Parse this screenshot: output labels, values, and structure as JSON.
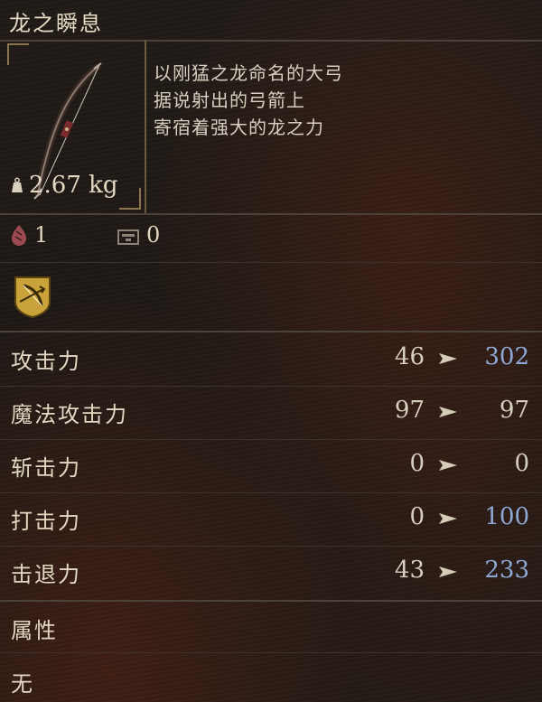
{
  "item": {
    "name": "龙之瞬息",
    "weight": "2.67 kg",
    "description": [
      "以刚猛之龙命名的大弓",
      "据说射出的弓箭上",
      "寄宿着强大的龙之力"
    ]
  },
  "requirements": {
    "fp_cost": "1",
    "stamina_cost": "0"
  },
  "stats": [
    {
      "label": "攻击力",
      "base": "46",
      "new": "302",
      "change": "up"
    },
    {
      "label": "魔法攻击力",
      "base": "97",
      "new": "97",
      "change": "same"
    },
    {
      "label": "斩击力",
      "base": "0",
      "new": "0",
      "change": "same"
    },
    {
      "label": "打击力",
      "base": "0",
      "new": "100",
      "change": "up"
    },
    {
      "label": "击退力",
      "base": "43",
      "new": "233",
      "change": "up"
    }
  ],
  "attribute": {
    "label": "属性",
    "value": "无"
  },
  "colors": {
    "increase": "#8ea9d6",
    "text": "#e2d8c2",
    "background": "#1e1814"
  }
}
